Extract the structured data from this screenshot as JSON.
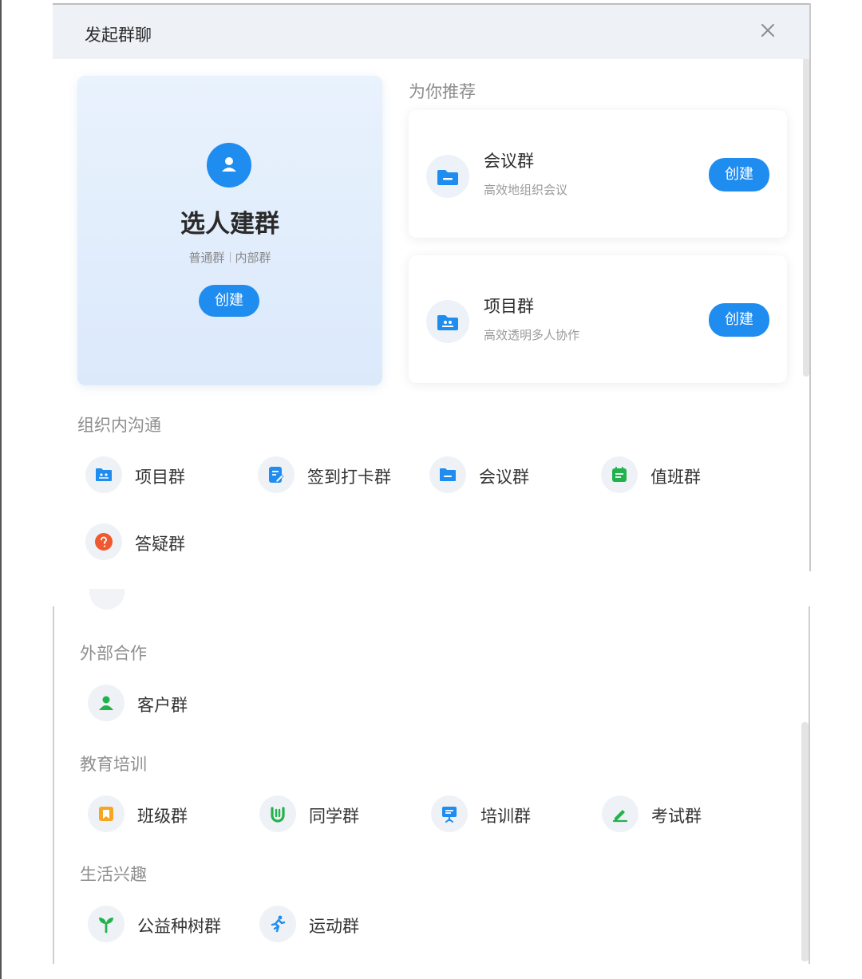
{
  "dialog": {
    "title": "发起群聊"
  },
  "main_card": {
    "title": "选人建群",
    "sub_left": "普通群",
    "sub_right": "内部群",
    "button": "创建"
  },
  "recommend": {
    "label": "为你推荐",
    "items": [
      {
        "name": "会议群",
        "desc": "高效地组织会议",
        "button": "创建",
        "icon": "folder-icon"
      },
      {
        "name": "项目群",
        "desc": "高效透明多人协作",
        "button": "创建",
        "icon": "team-folder-icon"
      }
    ]
  },
  "sections": {
    "internal": {
      "title": "组织内沟通",
      "items": [
        {
          "label": "项目群",
          "icon": "team-folder-icon"
        },
        {
          "label": "签到打卡群",
          "icon": "checkin-icon"
        },
        {
          "label": "会议群",
          "icon": "folder-icon"
        },
        {
          "label": "值班群",
          "icon": "calendar-icon"
        },
        {
          "label": "答疑群",
          "icon": "question-icon"
        }
      ]
    },
    "external": {
      "title": "外部合作",
      "items": [
        {
          "label": "客户群",
          "icon": "person-icon"
        }
      ]
    },
    "education": {
      "title": "教育培训",
      "items": [
        {
          "label": "班级群",
          "icon": "book-icon"
        },
        {
          "label": "同学群",
          "icon": "hand-icon"
        },
        {
          "label": "培训群",
          "icon": "easel-icon"
        },
        {
          "label": "考试群",
          "icon": "pencil-icon"
        }
      ]
    },
    "life": {
      "title": "生活兴趣",
      "items": [
        {
          "label": "公益种树群",
          "icon": "sprout-icon"
        },
        {
          "label": "运动群",
          "icon": "runner-icon"
        }
      ]
    }
  },
  "colors": {
    "primary": "#1f8cf0",
    "green": "#22b24c",
    "orange": "#f5a623",
    "red": "#f0582f",
    "header_bg": "#eef2f7"
  }
}
